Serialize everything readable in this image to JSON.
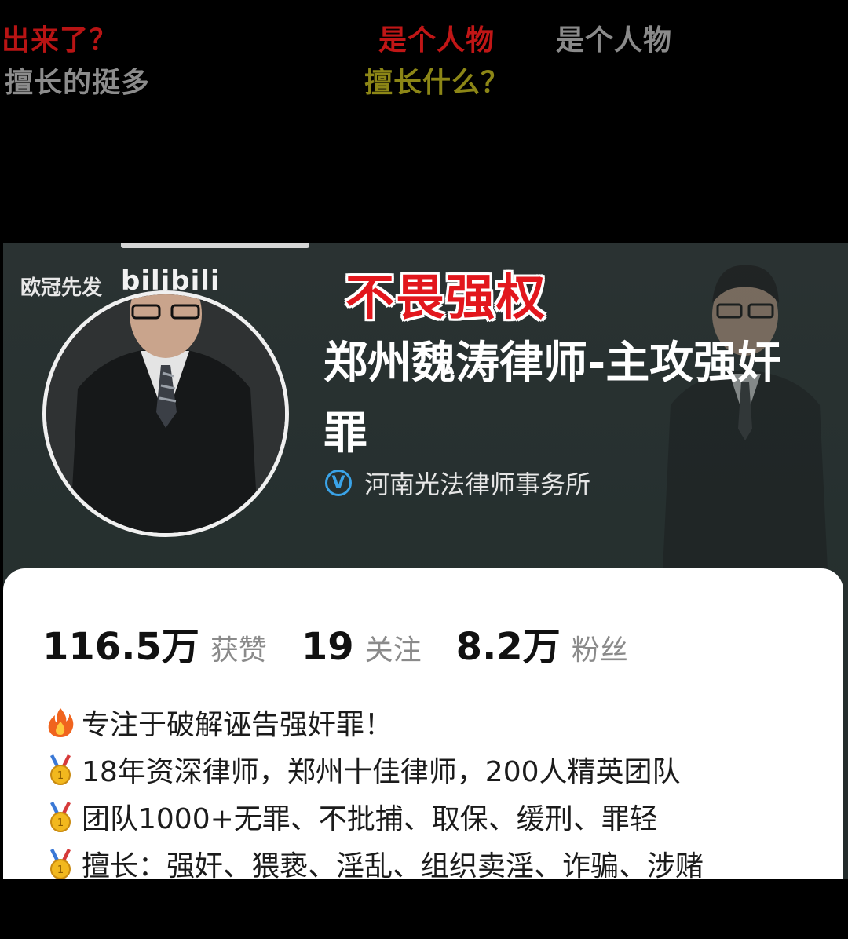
{
  "danmaku": [
    {
      "text": "出来了？"
    },
    {
      "text": "是个人物"
    },
    {
      "text": "是个人物"
    },
    {
      "text": "擅长的挺多"
    },
    {
      "text": "擅长什么？"
    }
  ],
  "watermark": {
    "label": "欧冠先发",
    "logo": "bilibili"
  },
  "profile": {
    "tagline": "不畏强权",
    "name": "郑州魏涛律师-主攻强奸罪",
    "verify_badge": "V",
    "organization": "河南光法律师事务所"
  },
  "stats": [
    {
      "value": "116.5万",
      "label": "获赞"
    },
    {
      "value": "19",
      "label": "关注"
    },
    {
      "value": "8.2万",
      "label": "粉丝"
    }
  ],
  "bio": [
    {
      "icon": "fire-icon",
      "text": "专注于破解诬告强奸罪！"
    },
    {
      "icon": "gold-medal-icon",
      "text": "18年资深律师，郑州十佳律师，200人精英团队"
    },
    {
      "icon": "gold-medal-icon",
      "text": "团队1000+无罪、不批捕、取保、缓刑、罪轻"
    },
    {
      "icon": "gold-medal-icon",
      "text": "擅长：强奸、猥亵、淫乱、组织卖淫、诈骗、涉赌"
    }
  ],
  "colors": {
    "danmaku_red": "#b81414",
    "danmaku_gray": "#8a8a8a",
    "danmaku_olive": "#8c8616",
    "tagline_red": "#e2171d",
    "verify_blue": "#3aa3e8"
  }
}
